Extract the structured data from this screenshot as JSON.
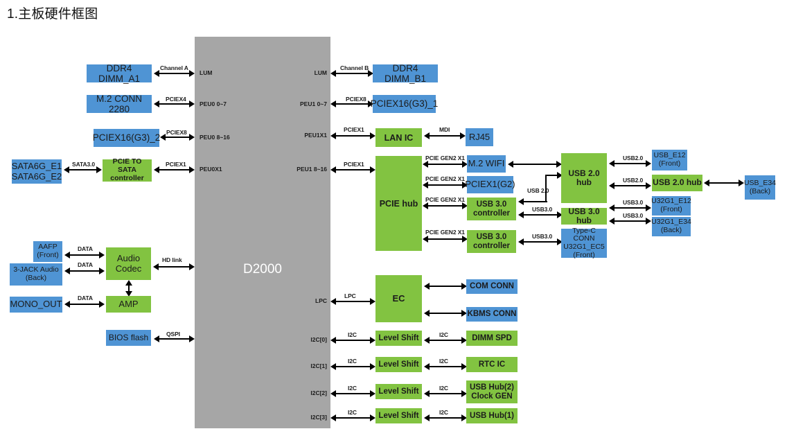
{
  "title": "1.主板硬件框图",
  "colors": {
    "blue": "#4f94d4",
    "green": "#82c341",
    "gray": "#a6a6a6",
    "line": "#000000"
  },
  "soc": {
    "name": "D2000",
    "left_pins": [
      "LUM",
      "PEU0 0~7",
      "PEU0 8~16",
      "PEU0X1"
    ],
    "right_pins": [
      "LUM",
      "PEU1 0~7",
      "PEU1X1",
      "PEU1 8~16",
      "LPC",
      "I2C[0]",
      "I2C[1]",
      "I2C[2]",
      "I2C[3]"
    ]
  },
  "blocks": {
    "ddr4_a1": "DDR4 DIMM_A1",
    "m2_conn": "M.2 CONN 2280",
    "pciex16_g3_2": "PCIEX16(G3)_2",
    "sata6g": "SATA6G_E1\nSATA6G_E2",
    "pcie_to_sata": "PCIE TO SATA\ncontroller",
    "aafp": "AAFP\n(Front)",
    "jack3": "3-JACK Audio\n(Back)",
    "mono_out": "MONO_OUT",
    "audio_codec": "Audio\nCodec",
    "amp": "AMP",
    "bios_flash": "BIOS flash",
    "ddr4_b1": "DDR4 DIMM_B1",
    "pciex16_g3_1": "PCIEX16(G3)_1",
    "lan_ic": "LAN IC",
    "rj45": "RJ45",
    "pcie_hub": "PCIE hub",
    "m2_wifi": "M.2 WIFI",
    "pciex1_g2": "PCIEX1(G2)",
    "usb30_ctrl_1": "USB 3.0\ncontroller",
    "usb30_ctrl_2": "USB 3.0\ncontroller",
    "usb20_hub_1": "USB 2.0 hub",
    "usb30_hub": "USB 3.0 hub",
    "typec_conn": "Type-C CONN\nU32G1_EC5\n(Front)",
    "usb_e12": "USB_E12\n(Front)",
    "usb20_hub_2": "USB 2.0 hub",
    "u32g1_e12": "U32G1_E12\n(Front)",
    "u32g1_e34": "U32G1_E34\n(Back)",
    "usb_e34": "USB_E34\n(Back)",
    "ec": "EC",
    "com_conn": "COM CONN",
    "kbms_conn": "KBMS CONN",
    "level_shift_0": "Level Shift",
    "level_shift_1": "Level Shift",
    "level_shift_2": "Level Shift",
    "level_shift_3": "Level Shift",
    "dimm_spd": "DIMM SPD",
    "rtc_ic": "RTC IC",
    "usb_hub2_clock": "USB Hub(2)\nClock GEN",
    "usb_hub1": "USB Hub(1)"
  },
  "link_labels": {
    "channel_a": "Channel A",
    "channel_b": "Channel B",
    "pciex4": "PCIEX4",
    "pciex8_left": "PCIEX8",
    "pciex8_right": "PCIEX8",
    "sata30": "SATA3.0",
    "pciex1_sata": "PCIEX1",
    "data_aafp": "DATA",
    "data_jack": "DATA",
    "data_mono": "DATA",
    "hd_link": "HD link",
    "qspi": "QSPI",
    "pciex1_lan": "PCIEX1",
    "mdi": "MDI",
    "pciex1_hub": "PCIEX1",
    "pcie_gen2x1_wifi": "PCIE GEN2 X1",
    "pcie_gen2x1_pciex1": "PCIE GEN2 X1",
    "pcie_gen2x1_usb1": "PCIE GEN2 X1",
    "pcie_gen2x1_usb2": "PCIE GEN2 X1",
    "usb20_wifi_hub": "USB 2.0",
    "usb30_ctrl1_hub": "USB3.0",
    "usb30_ctrl2_typec": "USB3.0",
    "usb20_e12": "USB2.0",
    "usb20_hub2": "USB2.0",
    "usb30_e12": "USB3.0",
    "usb30_e34": "USB3.0",
    "lpc": "LPC",
    "i2c_0a": "I2C",
    "i2c_0b": "I2C",
    "i2c_1a": "I2C",
    "i2c_1b": "I2C",
    "i2c_2a": "I2C",
    "i2c_2b": "I2C",
    "i2c_3a": "I2C",
    "i2c_3b": "I2C"
  }
}
